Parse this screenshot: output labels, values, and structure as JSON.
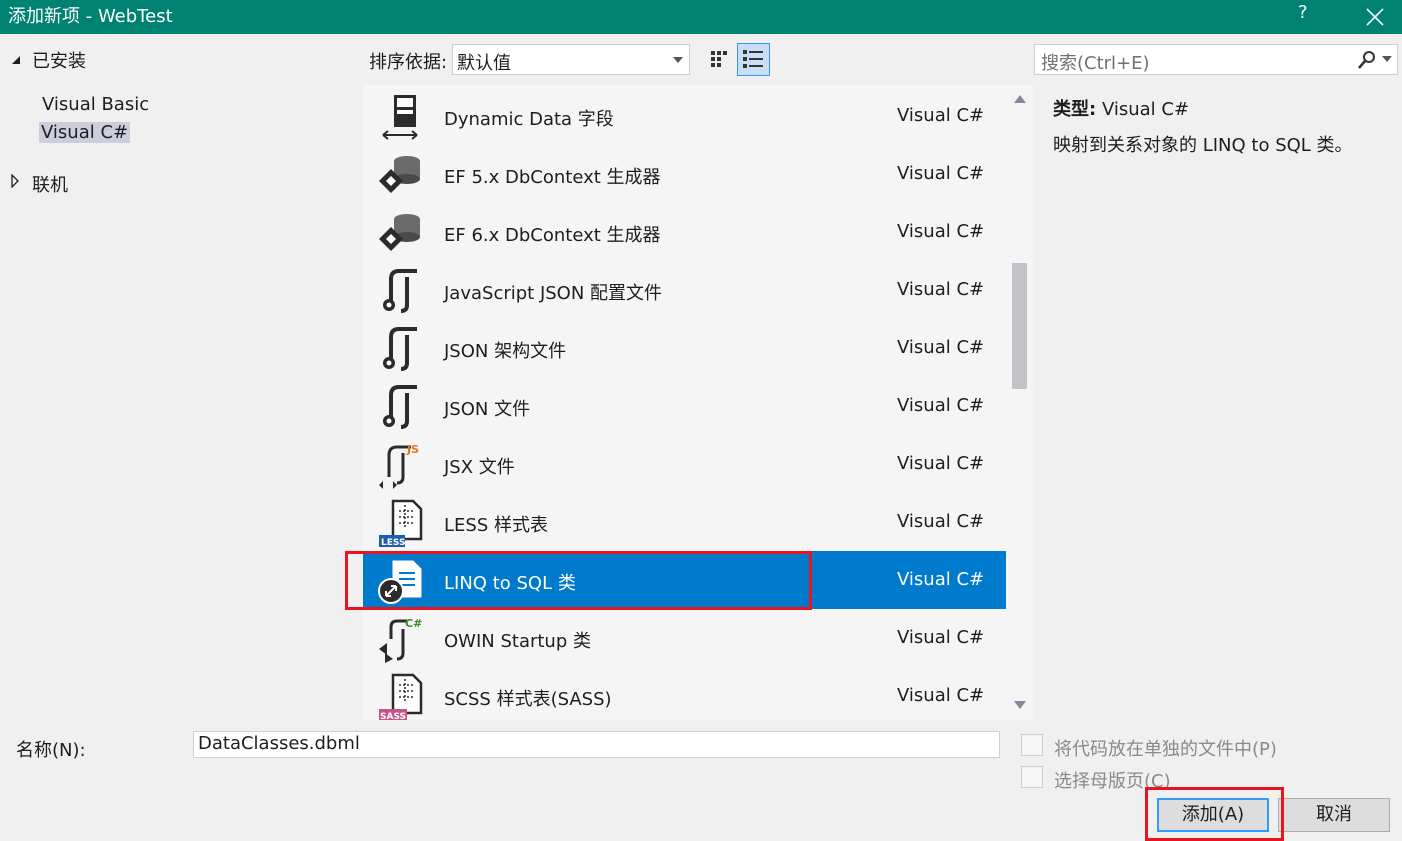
{
  "window": {
    "title": "添加新项 - WebTest",
    "help_label": "?"
  },
  "sidebar": {
    "installed_label": "已安装",
    "items": [
      "Visual Basic",
      "Visual C#"
    ],
    "online_label": "联机"
  },
  "toolbar": {
    "sort_label": "排序依据:",
    "sort_value": "默认值",
    "search_placeholder": "搜索(Ctrl+E)"
  },
  "templates": [
    {
      "name": "Dynamic Data 字段",
      "lang": "Visual C#",
      "icon": "dynamic-data-icon"
    },
    {
      "name": "EF 5.x DbContext 生成器",
      "lang": "Visual C#",
      "icon": "ef-generator-icon"
    },
    {
      "name": "EF 6.x DbContext 生成器",
      "lang": "Visual C#",
      "icon": "ef-generator-icon"
    },
    {
      "name": "JavaScript JSON 配置文件",
      "lang": "Visual C#",
      "icon": "json-file-icon"
    },
    {
      "name": "JSON 架构文件",
      "lang": "Visual C#",
      "icon": "json-file-icon"
    },
    {
      "name": "JSON 文件",
      "lang": "Visual C#",
      "icon": "json-file-icon"
    },
    {
      "name": "JSX 文件",
      "lang": "Visual C#",
      "icon": "jsx-file-icon"
    },
    {
      "name": "LESS 样式表",
      "lang": "Visual C#",
      "icon": "less-file-icon"
    },
    {
      "name": "LINQ to SQL 类",
      "lang": "Visual C#",
      "icon": "linq-to-sql-icon",
      "selected": true
    },
    {
      "name": "OWIN Startup 类",
      "lang": "Visual C#",
      "icon": "owin-startup-icon"
    },
    {
      "name": "SCSS 样式表(SASS)",
      "lang": "Visual C#",
      "icon": "scss-file-icon"
    }
  ],
  "icon_badges": {
    "jsx": "JS",
    "less": "LESS",
    "owin": "C#",
    "scss": "SASS"
  },
  "details": {
    "type_label": "类型:",
    "type_value": "Visual C#",
    "description": "映射到关系对象的 LINQ to SQL 类。"
  },
  "form": {
    "name_label": "名称(N):",
    "name_value": "DataClasses.dbml",
    "separate_file_label": "将代码放在单独的文件中(P)",
    "master_page_label": "选择母版页(C)",
    "add_button": "添加(A)",
    "cancel_button": "取消"
  },
  "colors": {
    "titlebar": "#008272",
    "selection": "#007acc",
    "highlight_box": "#e8141f"
  }
}
